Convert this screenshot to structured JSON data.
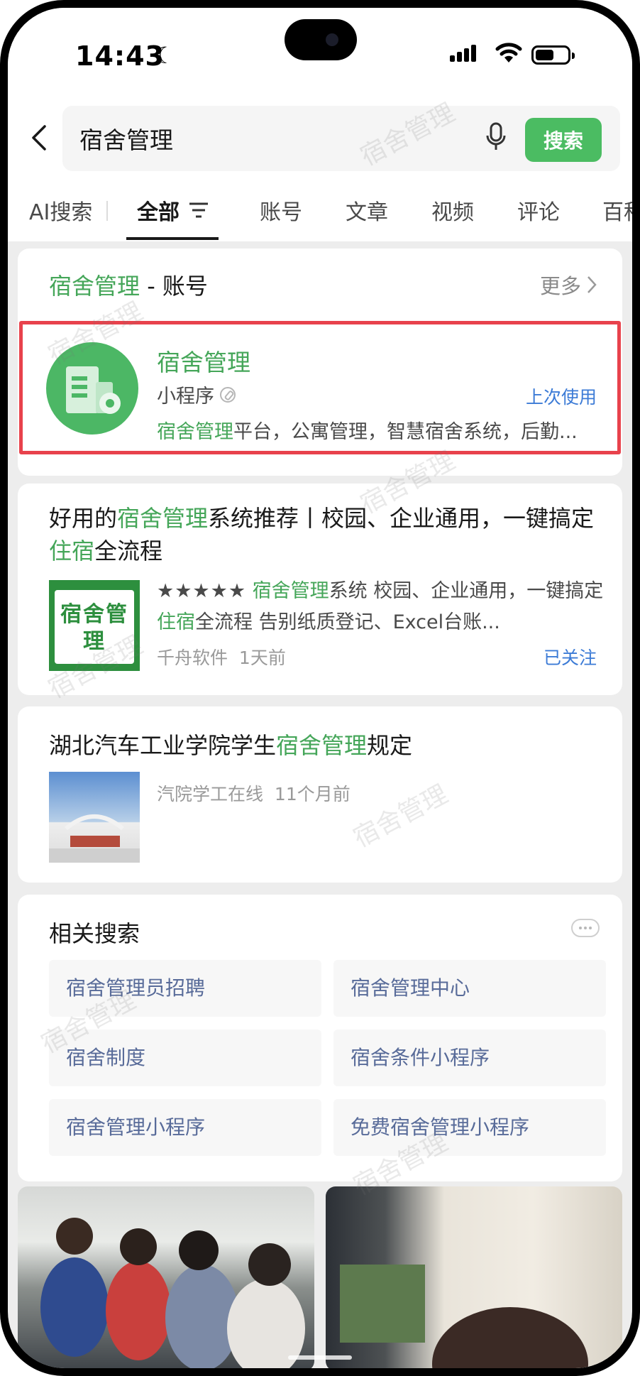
{
  "status_bar": {
    "time": "14:43"
  },
  "search": {
    "query": "宿舍管理",
    "button_label": "搜索"
  },
  "tabs": [
    {
      "label": "AI搜索"
    },
    {
      "label": "全部"
    },
    {
      "label": "账号"
    },
    {
      "label": "文章"
    },
    {
      "label": "视频"
    },
    {
      "label": "评论"
    },
    {
      "label": "百科"
    }
  ],
  "account_section": {
    "keyword": "宿舍管理",
    "suffix": " - 账号",
    "more_label": "更多",
    "result": {
      "name": "宿舍管理",
      "type": "小程序",
      "last_used": "上次使用",
      "desc_keyword": "宿舍管理",
      "desc_rest": "平台，公寓管理，智慧宿舍系统，后勤..."
    }
  },
  "article1": {
    "title_parts": [
      "好用的",
      "宿舍管理",
      "系统推荐丨校园、企业通用，一键搞定",
      "住宿",
      "全流程"
    ],
    "thumb_text": "宿舍管理",
    "stars": "★★★★★",
    "summary_parts": [
      " ",
      "宿舍管理",
      "系统 校园、企业通用，一键搞定",
      "住宿",
      "全流程 告别纸质登记、Excel台账..."
    ],
    "source": "千舟软件",
    "time": "1天前",
    "follow_status": "已关注"
  },
  "article2": {
    "title_parts": [
      "湖北汽车工业学院学生",
      "宿舍管理",
      "规定"
    ],
    "source": "汽院学工在线",
    "time": "11个月前"
  },
  "related": {
    "title": "相关搜索",
    "items": [
      "宿舍管理员招聘",
      "宿舍管理中心",
      "宿舍制度",
      "宿舍条件小程序",
      "宿舍管理小程序",
      "免费宿舍管理小程序"
    ]
  },
  "watermark": "宿舍管理",
  "colors": {
    "accent_green": "#45a659",
    "button_green": "#4bbc62",
    "link_blue": "#3c7bd6",
    "highlight_red": "#e8424c"
  }
}
